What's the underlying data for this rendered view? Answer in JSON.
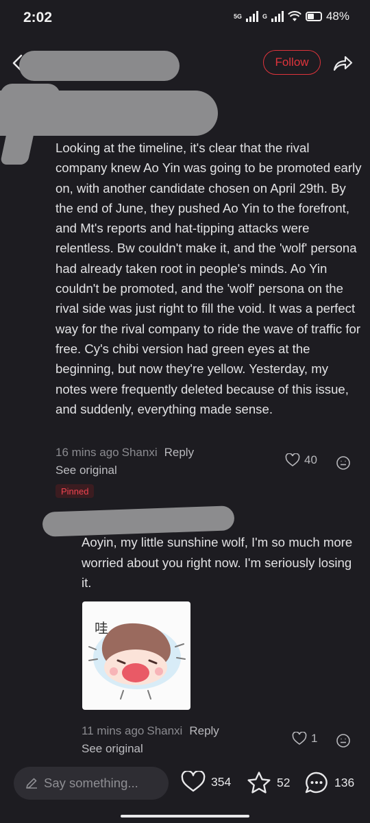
{
  "status_bar": {
    "time": "2:02",
    "network": "5G",
    "network2": "G",
    "battery": "48%"
  },
  "header": {
    "follow_label": "Follow"
  },
  "comment": {
    "text": "Looking at the timeline, it's clear that the rival company knew Ao Yin was going to be promoted early on, with another candidate chosen on April 29th. By the end of June, they pushed Ao Yin to the forefront, and Mt's reports and hat-tipping attacks were relentless. Bw couldn't make it, and the 'wolf' persona had already taken root in people's minds. Ao Yin couldn't be promoted, and the 'wolf' persona on the rival side was just right to fill the void. It was a perfect way for the rival company to ride the wave of traffic for free. Cy's chibi version had green eyes at the beginning, but now they're yellow. Yesterday, my notes were frequently deleted because of this issue, and suddenly, everything made sense.",
    "time": "16 mins ago",
    "location": "Shanxi",
    "reply_label": "Reply",
    "see_original": "See original",
    "likes": "40",
    "pinned_label": "Pinned"
  },
  "reply": {
    "text": "Aoyin, my little sunshine wolf, I'm so much more worried about you right now. I'm seriously losing it.",
    "sticker_text": "哇",
    "time": "11 mins ago",
    "location": "Shanxi",
    "reply_label": "Reply",
    "see_original": "See original",
    "likes": "1"
  },
  "bottom_bar": {
    "input_placeholder": "Say something...",
    "likes_count": "354",
    "favorites_count": "52",
    "comments_count": "136"
  },
  "colors": {
    "accent": "#e0343c",
    "background": "#1d1c21",
    "muted_text": "#8b8b90"
  },
  "icons": [
    "back-icon",
    "share-icon",
    "heart-icon",
    "emoji-icon",
    "pencil-icon",
    "star-icon",
    "comment-icon"
  ]
}
